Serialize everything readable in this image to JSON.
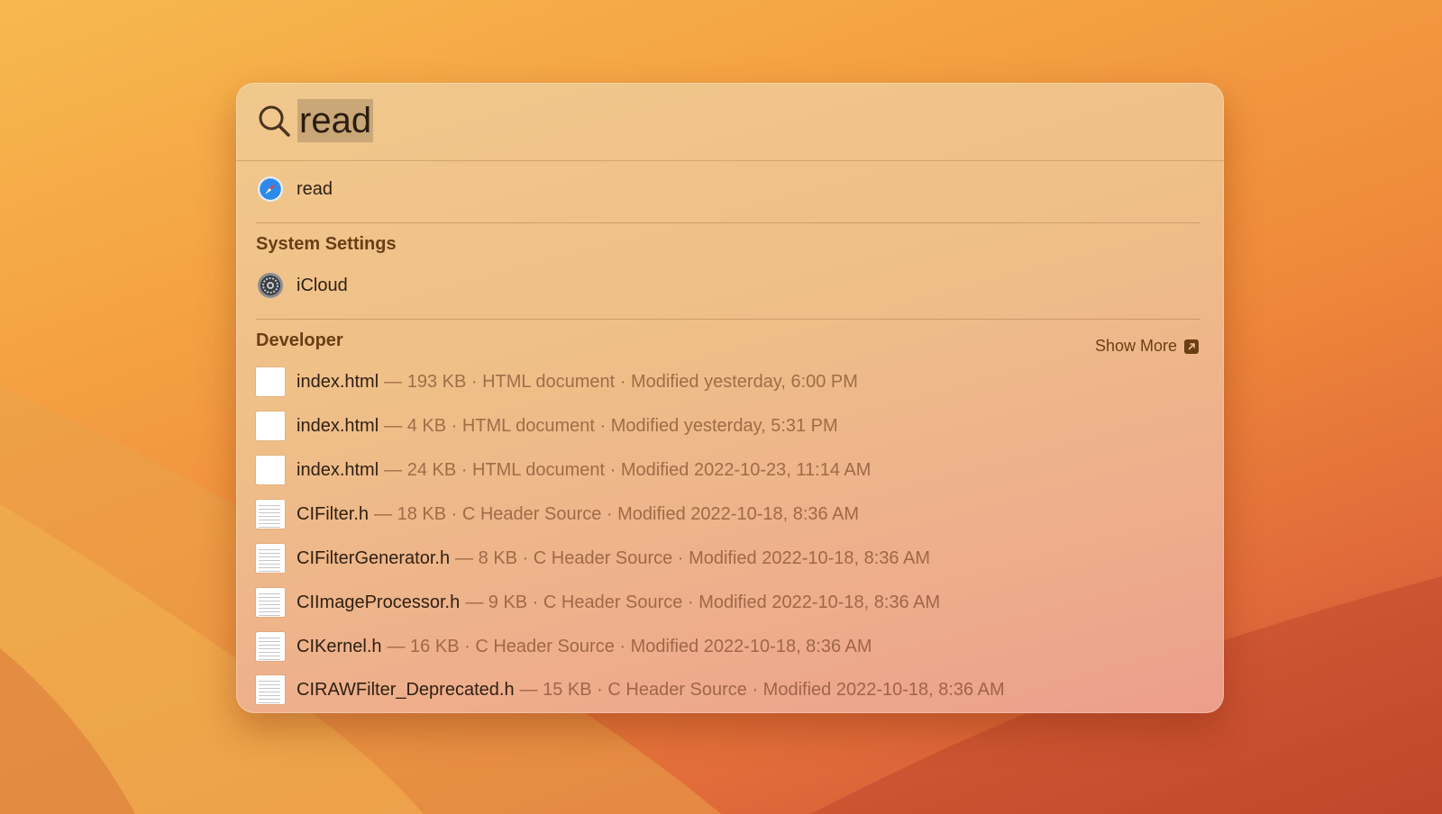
{
  "search": {
    "query": "read"
  },
  "web_result": {
    "label": "read",
    "icon": "safari-compass-icon"
  },
  "system_settings": {
    "title": "System Settings",
    "item": {
      "label": "iCloud",
      "icon": "system-settings-gear-icon"
    }
  },
  "developer": {
    "title": "Developer",
    "show_more": "Show More",
    "items": [
      {
        "name": "index.html",
        "meta": "— 193 KB · HTML document · Modified yesterday, 6:00 PM",
        "icon": "blank-document-icon"
      },
      {
        "name": "index.html",
        "meta": "— 4 KB · HTML document · Modified yesterday, 5:31 PM",
        "icon": "blank-document-icon"
      },
      {
        "name": "index.html",
        "meta": "— 24 KB · HTML document · Modified 2022-10-23, 11:14 AM",
        "icon": "blank-document-icon"
      },
      {
        "name": "CIFilter.h",
        "meta": "— 18 KB · C Header Source · Modified 2022-10-18, 8:36 AM",
        "icon": "header-document-icon"
      },
      {
        "name": "CIFilterGenerator.h",
        "meta": "— 8 KB · C Header Source · Modified 2022-10-18, 8:36 AM",
        "icon": "header-document-icon"
      },
      {
        "name": "CIImageProcessor.h",
        "meta": "— 9 KB · C Header Source · Modified 2022-10-18, 8:36 AM",
        "icon": "header-document-icon"
      },
      {
        "name": "CIKernel.h",
        "meta": "— 16 KB · C Header Source · Modified 2022-10-18, 8:36 AM",
        "icon": "header-document-icon"
      },
      {
        "name": "CIRAWFilter_Deprecated.h",
        "meta": "— 15 KB · C Header Source · Modified 2022-10-18, 8:36 AM",
        "icon": "header-document-icon"
      }
    ]
  }
}
